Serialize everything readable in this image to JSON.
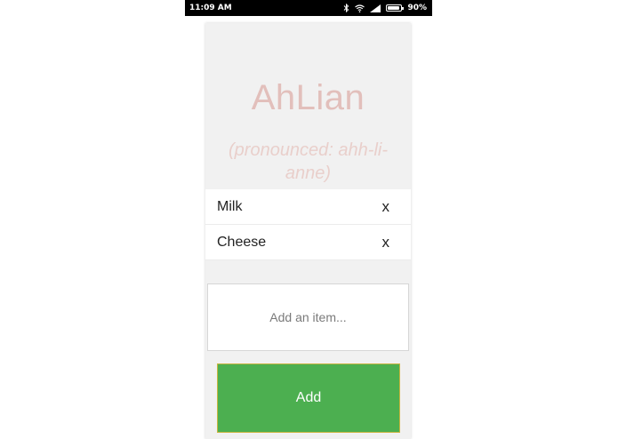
{
  "status_bar": {
    "time": "11:09 AM",
    "battery_percent": "90%",
    "battery_level": 0.9,
    "icons": [
      "bluetooth-icon",
      "wifi-icon",
      "signal-icon",
      "battery-icon"
    ]
  },
  "header": {
    "title": "AhLian",
    "subtitle": "(pronounced: ahh-li-anne)"
  },
  "items": [
    {
      "name": "Milk",
      "remove_label": "x"
    },
    {
      "name": "Cheese",
      "remove_label": "x"
    }
  ],
  "add_form": {
    "input_placeholder": "Add an item...",
    "input_value": "",
    "button_label": "Add"
  },
  "colors": {
    "title": "#e2bfbb",
    "button": "#4caf50",
    "background": "#f1f1f1"
  }
}
